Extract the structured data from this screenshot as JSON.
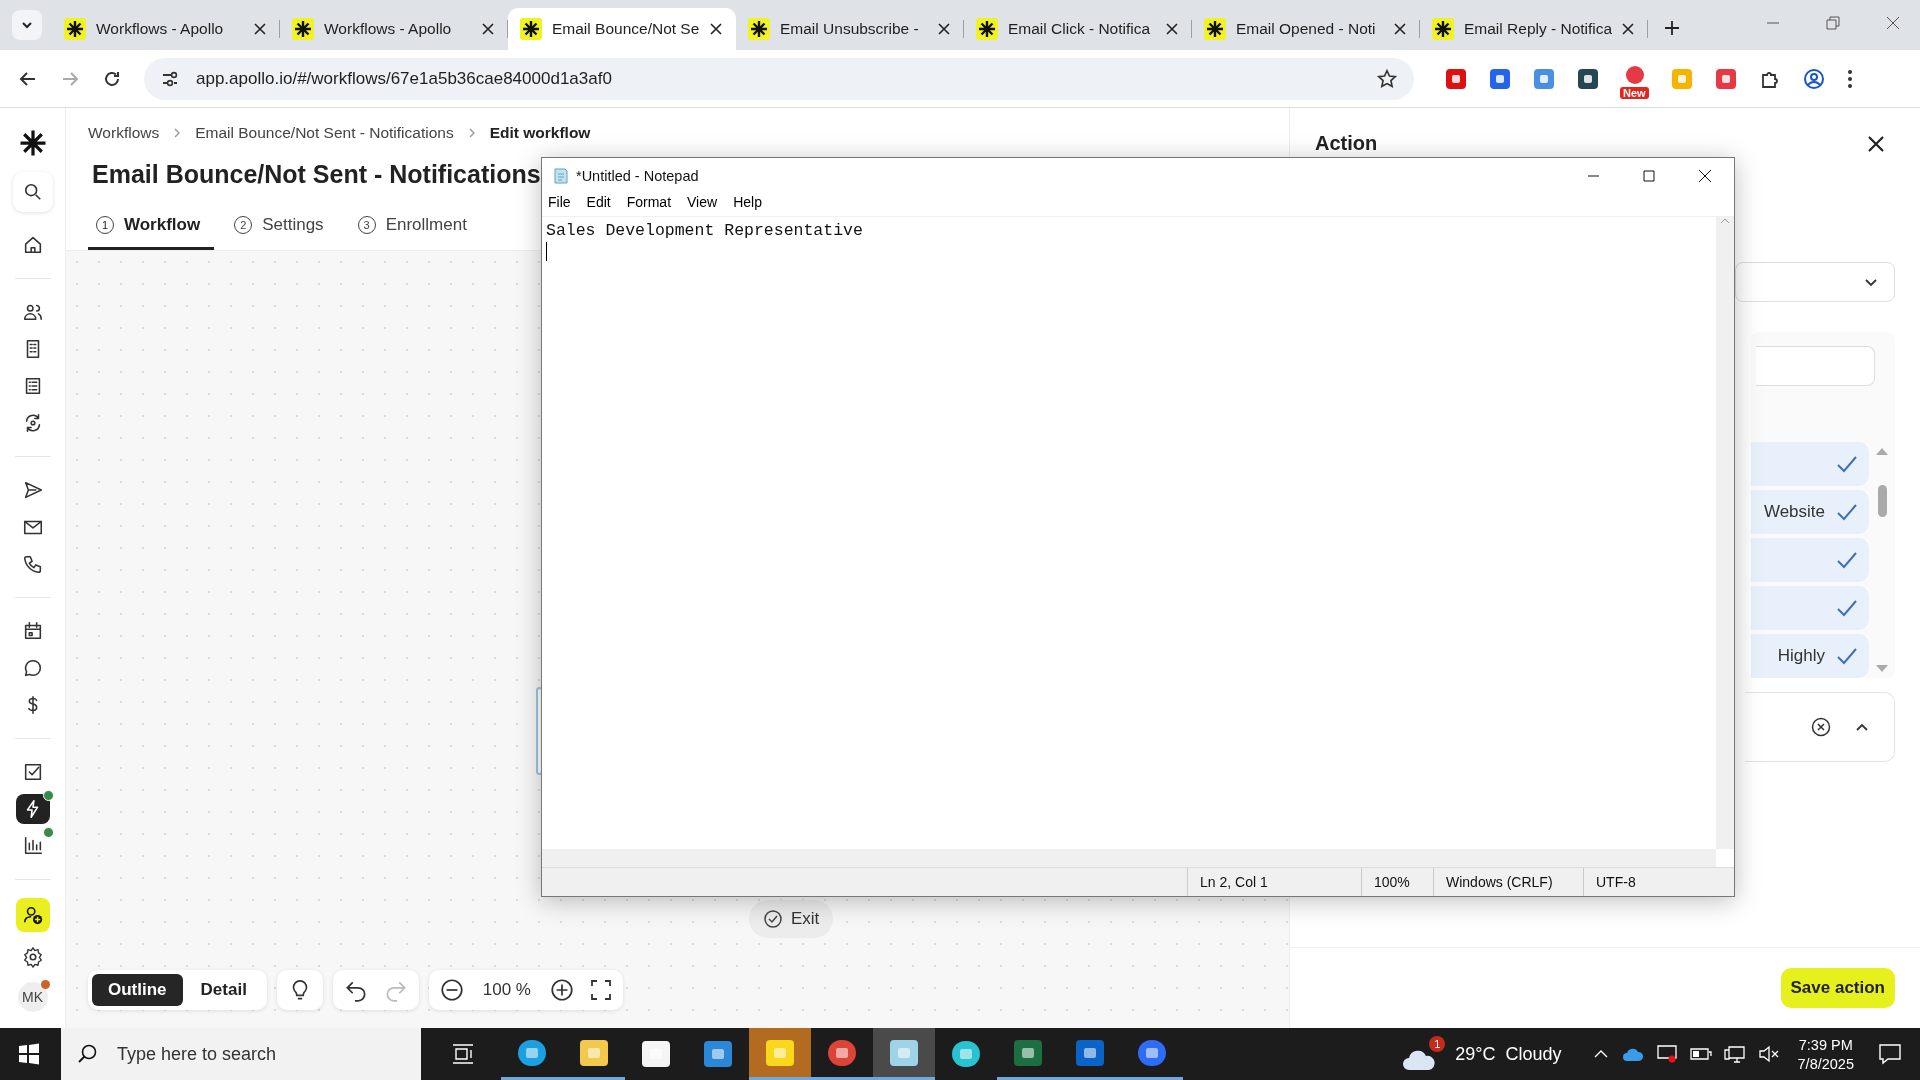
{
  "browser": {
    "tabs": [
      {
        "label": "Workflows - Apollo",
        "selected": false
      },
      {
        "label": "Workflows - Apollo",
        "selected": false
      },
      {
        "label": "Email Bounce/Not Se",
        "selected": true
      },
      {
        "label": "Email Unsubscribe -",
        "selected": false
      },
      {
        "label": "Email Click - Notifica",
        "selected": false
      },
      {
        "label": "Email Opened - Noti",
        "selected": false
      },
      {
        "label": "Email Reply - Notifica",
        "selected": false
      }
    ],
    "url": "app.apollo.io/#/workflows/67e1a5b36cae84000d1a3af0",
    "extension_badge": "New"
  },
  "sidebar": {
    "items": [
      {
        "selected": false,
        "notify": false
      },
      {
        "selected": false,
        "notify": false
      },
      {
        "selected": false,
        "notify": false
      },
      {
        "selected": false,
        "notify": false
      },
      {
        "selected": false,
        "notify": false
      },
      {
        "selected": false,
        "notify": false
      },
      {
        "selected": false,
        "notify": false
      },
      {
        "selected": false,
        "notify": false
      },
      {
        "selected": false,
        "notify": false
      },
      {
        "selected": false,
        "notify": false
      },
      {
        "selected": false,
        "notify": false
      },
      {
        "selected": false,
        "notify": false
      },
      {
        "selected": true,
        "notify": true
      },
      {
        "selected": false,
        "notify": true
      },
      {
        "selected": false,
        "notify": false
      }
    ],
    "avatar": "MK"
  },
  "breadcrumbs": [
    "Workflows",
    "Email Bounce/Not Sent - Notifications",
    "Edit workflow"
  ],
  "title": "Email Bounce/Not Sent - Notifications",
  "steps": [
    {
      "number": "1",
      "label": "Workflow",
      "selected": true
    },
    {
      "number": "2",
      "label": "Settings",
      "selected": false
    },
    {
      "number": "3",
      "label": "Enrollment",
      "selected": false
    }
  ],
  "canvas": {
    "exit_label": "Exit"
  },
  "toolbar": {
    "views": [
      {
        "label": "Outline",
        "selected": true
      },
      {
        "label": "Detail",
        "selected": false
      }
    ],
    "redo_disabled": true,
    "zoom": "100 %"
  },
  "action_panel": {
    "title": "Action",
    "options": [
      {
        "selected": true
      },
      {
        "label": "Website",
        "selected": true
      },
      {
        "selected": true
      },
      {
        "selected": true
      },
      {
        "label": "Highly",
        "selected": true
      }
    ],
    "save_label": "Save action"
  },
  "notepad": {
    "title": "*Untitled - Notepad",
    "menu": [
      "File",
      "Edit",
      "Format",
      "View",
      "Help"
    ],
    "lines": [
      "Sales Development Representative"
    ],
    "status": [
      "Ln 2, Col 1",
      "100%",
      "Windows (CRLF)",
      "UTF-8"
    ]
  },
  "taskbar": {
    "search_placeholder": "Type here to search",
    "apps": [
      {
        "running": true,
        "selected": false
      },
      {
        "running": true,
        "selected": false
      },
      {
        "running": false,
        "selected": false
      },
      {
        "running": false,
        "selected": false
      },
      {
        "running": true,
        "selected": true
      },
      {
        "running": true,
        "selected": false
      },
      {
        "running": true,
        "selected": true
      },
      {
        "running": false,
        "selected": false
      },
      {
        "running": true,
        "selected": false
      },
      {
        "running": true,
        "selected": false
      },
      {
        "running": true,
        "selected": false
      }
    ],
    "weather_badge": "1",
    "temperature": "29°C",
    "weather": "Cloudy",
    "time": "7:39 PM",
    "date": "7/8/2025"
  }
}
